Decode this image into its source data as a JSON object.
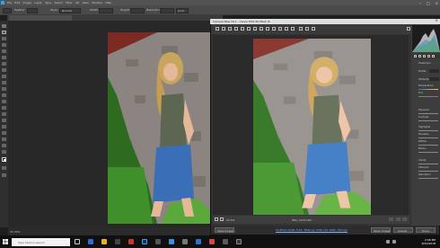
{
  "ps": {
    "menu": [
      "File",
      "Edit",
      "Image",
      "Layer",
      "Type",
      "Select",
      "Filter",
      "3D",
      "View",
      "Window",
      "Help"
    ],
    "opt_feather_label": "Feather:",
    "opt_style_label": "Style:",
    "opt_style_value": "Normal",
    "opt_width_label": "Width:",
    "opt_height_label": "Height:",
    "opt_resolution_label": "Resolution:",
    "opt_resolution_value": "px/in",
    "tab_title": "",
    "zoom_readout": "33.33%"
  },
  "acr": {
    "title": "Camera Raw 10.1 - Canon EOS 5D Mark III",
    "zoom": "22.6%",
    "filename": "IMG_1234.CR2",
    "workflow_link": "ProPhoto RGB; 8 bit; 3840 by 5760 (22.1MP); 300 ppi",
    "save_label": "Save Image...",
    "open_label": "Open Image",
    "cancel_label": "Cancel",
    "done_label": "Done",
    "panel": {
      "treatment_label": "Treatment:",
      "profile_label": "Profile:",
      "white_balance_label": "White Balance:",
      "temperature_label": "Temperature",
      "tint_label": "Tint",
      "exposure_label": "Exposure",
      "contrast_label": "Contrast",
      "highlights_label": "Highlights",
      "shadows_label": "Shadows",
      "whites_label": "Whites",
      "blacks_label": "Blacks",
      "clarity_label": "Clarity",
      "vibrance_label": "Vibrance",
      "saturation_label": "Saturation"
    }
  },
  "taskbar": {
    "search_placeholder": "Type here to search",
    "time": "2:06 PM",
    "date": "8/10/2018"
  },
  "colors": {
    "ps_bg": "#1e1e1e",
    "acr_bg": "#333333",
    "accent": "#2fa3f7",
    "skirt": "#3a6fb8",
    "wall": "#8b8480"
  }
}
